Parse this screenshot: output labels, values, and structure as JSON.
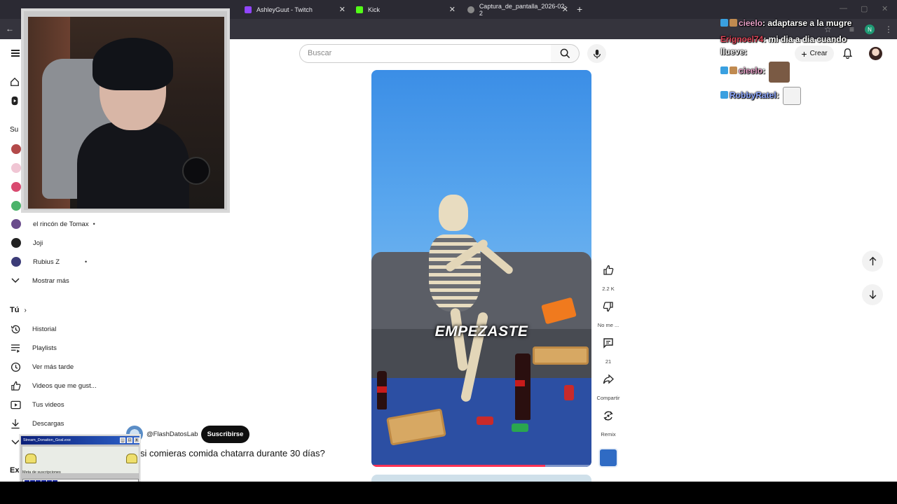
{
  "browser": {
    "tabs": [
      {
        "label": "AshleyGuut - Twitch",
        "color": "#9146ff"
      },
      {
        "label": "Kick",
        "color": "#53fc18"
      },
      {
        "label": "Captura_de_pantalla_2026-02-2",
        "color": "#aaaaaa"
      }
    ],
    "profile_initial": "N"
  },
  "youtube": {
    "search_placeholder": "Buscar",
    "create_label": "Crear",
    "sidebar": {
      "channels": [
        {
          "name": "el rincón de Tomax",
          "color": "#6a4c8c",
          "dot": "•"
        },
        {
          "name": "Joji",
          "color": "#222222",
          "dot": ""
        },
        {
          "name": "Rubius Z",
          "color": "#3c3c78",
          "dot": "•"
        }
      ],
      "show_more": "Mostrar más",
      "you_section": "Tú",
      "you_items": [
        {
          "label": "Historial",
          "icon": "history-icon"
        },
        {
          "label": "Playlists",
          "icon": "playlists-icon"
        },
        {
          "label": "Ver más tarde",
          "icon": "watch-later-icon"
        },
        {
          "label": "Videos que me gust...",
          "icon": "liked-videos-icon"
        },
        {
          "label": "Tus videos",
          "icon": "your-videos-icon"
        },
        {
          "label": "Descargas",
          "icon": "downloads-icon"
        }
      ],
      "partial_sub": "Su",
      "partial_ex": "Ex"
    },
    "short": {
      "caption_text": "EMPEZASTE",
      "progress": 0.79,
      "channel_handle": "@FlashDatosLab",
      "subscribe_label": "Suscribirse",
      "title": "si comieras comida chatarra durante 30 días?"
    },
    "actions": {
      "likes": "2.2 K",
      "dislike_label": "No me ...",
      "comments": "21",
      "share_label": "Compartir",
      "remix_label": "Remix"
    }
  },
  "donation_widget": {
    "title": "Stream_Donation_Goal.exe",
    "label": "Meta de suscripciones",
    "filled_segments": 6
  },
  "chat": [
    {
      "user": "cieelo",
      "user_color": "#e8a0c8",
      "message": " adaptarse a la mugre"
    },
    {
      "user": "Erignoel74",
      "user_color": "#e0475a",
      "message": " mi dia a dia cuando"
    },
    {
      "user": "",
      "user_color": "#e0475a",
      "message": "llueve"
    },
    {
      "user": "cieelo",
      "user_color": "#e8a0c8",
      "message": ""
    },
    {
      "user": "RobbyRatel",
      "user_color": "#8fa9ff",
      "message": ""
    }
  ]
}
